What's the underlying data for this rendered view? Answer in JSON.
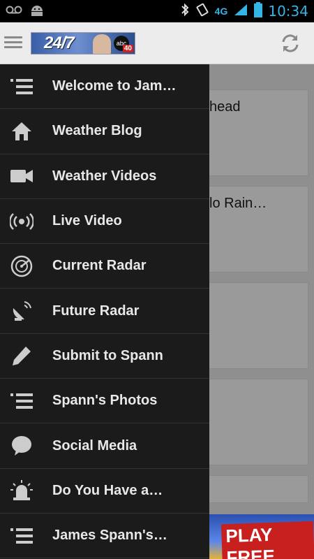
{
  "status_bar": {
    "time": "10:34",
    "network": "4G",
    "icons": [
      "voicemail-icon",
      "android-icon",
      "bluetooth-icon",
      "vibrate-icon",
      "signal-icon",
      "battery-icon"
    ]
  },
  "action_bar": {
    "logo_text": "24/7",
    "logo_channel": "40",
    "logo_network": "abc"
  },
  "drawer": {
    "items": [
      {
        "label": "Welcome to Jam…",
        "icon": "list-icon"
      },
      {
        "label": "Weather Blog",
        "icon": "home-icon"
      },
      {
        "label": "Weather Videos",
        "icon": "video-camera-icon"
      },
      {
        "label": "Live Video",
        "icon": "broadcast-icon"
      },
      {
        "label": "Current Radar",
        "icon": "radar-icon"
      },
      {
        "label": "Future Radar",
        "icon": "satellite-dish-icon"
      },
      {
        "label": "Submit to Spann",
        "icon": "pencil-icon"
      },
      {
        "label": "Spann's Photos",
        "icon": "list-icon"
      },
      {
        "label": "Social Media",
        "icon": "speech-bubble-icon"
      },
      {
        "label": "Do You Have a…",
        "icon": "siren-icon"
      },
      {
        "label": "James Spann's…",
        "icon": "list-icon"
      }
    ]
  },
  "background": {
    "card1_text": "head",
    "card2_text": "lo Rain…",
    "ad_text": "PLAY FREE"
  },
  "colors": {
    "status_accent": "#33b5e5",
    "drawer_bg": "#1b1b1b",
    "actionbar_bg": "#ececec"
  }
}
